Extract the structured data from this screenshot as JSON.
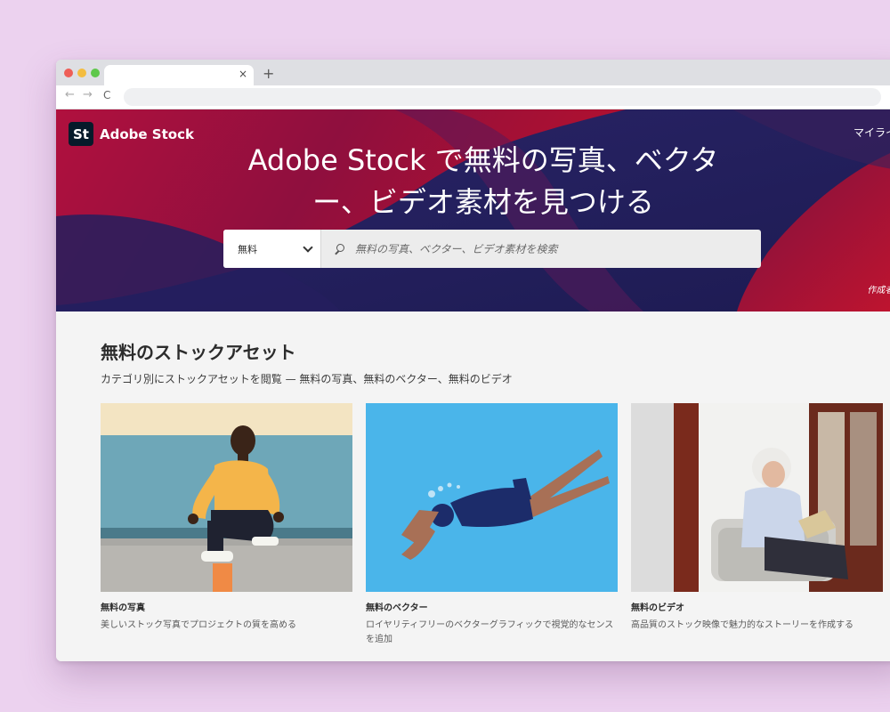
{
  "browser": {
    "tab_close": "×",
    "new_tab": "+",
    "back": "←",
    "forward": "→",
    "reload": "C"
  },
  "header": {
    "logo_mark": "St",
    "brand": "Adobe Stock",
    "top_link": "マイライブラ",
    "headline_line1": "Adobe Stock で無料の写真、ベクタ",
    "headline_line2": "ー、ビデオ素材を見つける",
    "credit": "作成者 : Gst"
  },
  "search": {
    "filter_value": "無料",
    "placeholder": "無料の写真、ベクター、ビデオ素材を検索"
  },
  "section": {
    "title": "無料のストックアセット",
    "subtitle": "カテゴリ別にストックアセットを閲覧 — 無料の写真、無料のベクター、無料のビデオ",
    "cards": [
      {
        "title": "無料の写真",
        "description": "美しいストック写真でプロジェクトの質を高める"
      },
      {
        "title": "無料のベクター",
        "description": "ロイヤリティフリーのベクターグラフィックで視覚的なセンスを追加"
      },
      {
        "title": "無料のビデオ",
        "description": "高品質のストック映像で魅力的なストーリーを作成する"
      }
    ]
  },
  "colors": {
    "page_background": "#ecd2ef",
    "hero_red": "#c0103a",
    "hero_navy": "#2b2263",
    "vector_sky": "#4ab5ea"
  }
}
